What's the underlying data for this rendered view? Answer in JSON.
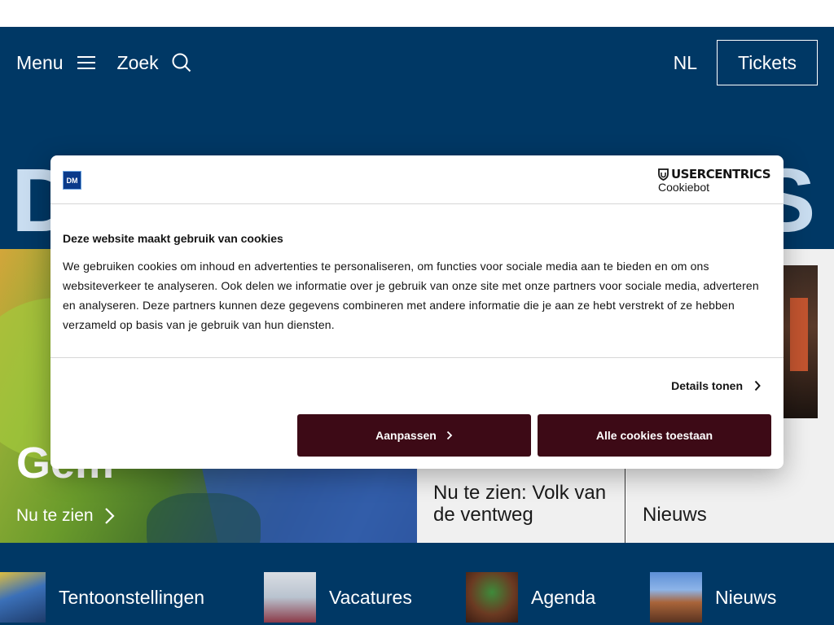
{
  "header": {
    "menu_label": "Menu",
    "search_label": "Zoek",
    "lang_label": "NL",
    "tickets_label": "Tickets",
    "bigword_left": "D",
    "bigword_right": "S"
  },
  "hero": {
    "title": "Gem",
    "link_label": "Nu te zien"
  },
  "cards": [
    {
      "title": "Nu te zien: Volk van de ventweg"
    },
    {
      "title": "Nieuws"
    }
  ],
  "bottom_nav": [
    {
      "label": "Tentoonstellingen"
    },
    {
      "label": "Vacatures"
    },
    {
      "label": "Agenda"
    },
    {
      "label": "Nieuws"
    }
  ],
  "cookie_dialog": {
    "logo_text": "DM",
    "brand_name": "USERCENTRICS",
    "brand_sub": "Cookiebot",
    "title": "Deze website maakt gebruik van cookies",
    "text": "We gebruiken cookies om inhoud en advertenties te personaliseren, om functies voor sociale media aan te bieden en om ons websiteverkeer te analyseren. Ook delen we informatie over je gebruik van onze site met onze partners voor sociale media, adverteren en analyseren. Deze partners kunnen deze gegevens combineren met andere informatie die je aan ze hebt verstrekt of ze hebben verzameld op basis van je gebruik van hun diensten.",
    "details_label": "Details tonen",
    "adjust_label": "Aanpassen",
    "allow_all_label": "Alle cookies toestaan"
  },
  "icons": {
    "menu": "hamburger-icon",
    "search": "magnifier-icon",
    "chevron": "chevron-right-icon"
  },
  "colors": {
    "brand_blue": "#003865",
    "button_dark": "#3d0a16",
    "big_letters": "#c9ddf0"
  }
}
